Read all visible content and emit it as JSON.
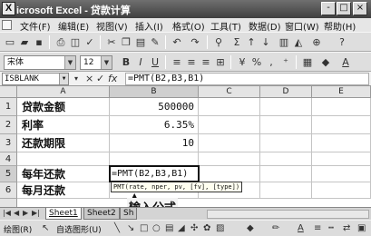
{
  "window": {
    "title": "icrosoft Excel - 贷款计算",
    "app_icon_letter": "X",
    "buttons": [
      "-",
      "□",
      "×"
    ]
  },
  "menubar": {
    "items": [
      "文件(F)",
      "编辑(E)",
      "视图(V)",
      "插入(I)",
      "格式(O)",
      "工具(T)",
      "数据(D)",
      "窗口(W)",
      "帮助(H)"
    ]
  },
  "formula_bar": {
    "name_box": "ISBLANK",
    "fx_symbols": [
      "▾",
      "×",
      "✓",
      "fx"
    ],
    "content": "=PMT(B2,B3,B1)"
  },
  "toolbar": {
    "font_name": "宋体",
    "font_size": "12",
    "sigma": "Σ"
  },
  "sheet": {
    "columns": [
      "A",
      "B",
      "C",
      "D",
      "E"
    ],
    "rows": [
      {
        "num": "1",
        "a": "贷款金额",
        "b": "500000"
      },
      {
        "num": "2",
        "a": "利率",
        "b": "6.35%"
      },
      {
        "num": "3",
        "a": "还款期限",
        "b": "10"
      },
      {
        "num": "4",
        "a": "",
        "b": ""
      },
      {
        "num": "5",
        "a": "每年还款",
        "b": "=PMT(B2,B3,B1)"
      },
      {
        "num": "6",
        "a": "每月还款",
        "b": ""
      }
    ],
    "tooltip": "PMT(rate, nper, pv, [fv], [type])",
    "callout": "输入公式"
  },
  "tabs": {
    "nav": [
      "|◀",
      "◀",
      "▶",
      "▶|"
    ],
    "sheets": [
      "Sheet1",
      "Sheet2",
      "Sh"
    ]
  },
  "drawing": {
    "draw_label": "绘图(R)",
    "autoshape_label": "自选图形(U)"
  }
}
